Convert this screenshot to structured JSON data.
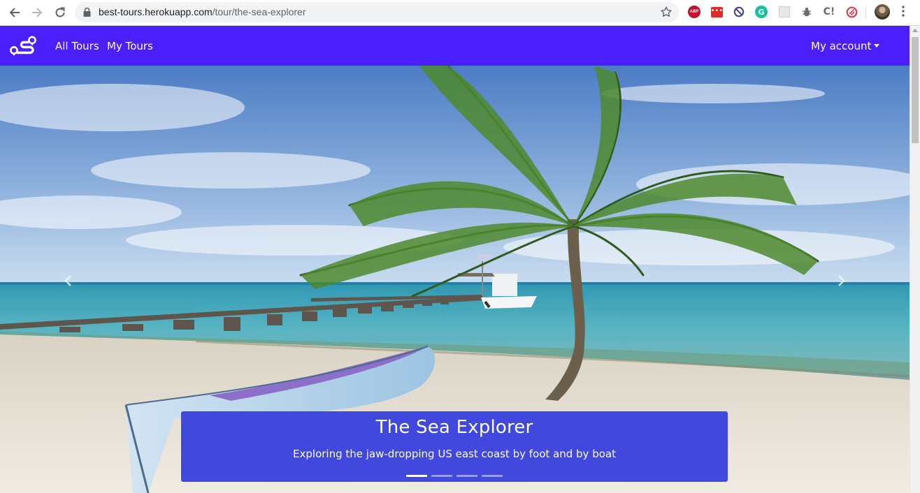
{
  "browser": {
    "url_domain": "best-tours.herokuapp.com",
    "url_path": "/tour/the-sea-explorer",
    "extensions": {
      "abp_label": "ABP",
      "dots_label": "•••",
      "grammarly_label": "G",
      "c_label": "C!"
    }
  },
  "navbar": {
    "links": [
      "All Tours",
      "My Tours"
    ],
    "account_label": "My account",
    "bg_color": "#4a1ffb"
  },
  "hero": {
    "title": "The Sea Explorer",
    "subtitle": "Exploring the jaw-dropping US east coast by foot and by boat",
    "slide_count": 4,
    "active_slide": 1,
    "caption_color": "#3a42de"
  }
}
